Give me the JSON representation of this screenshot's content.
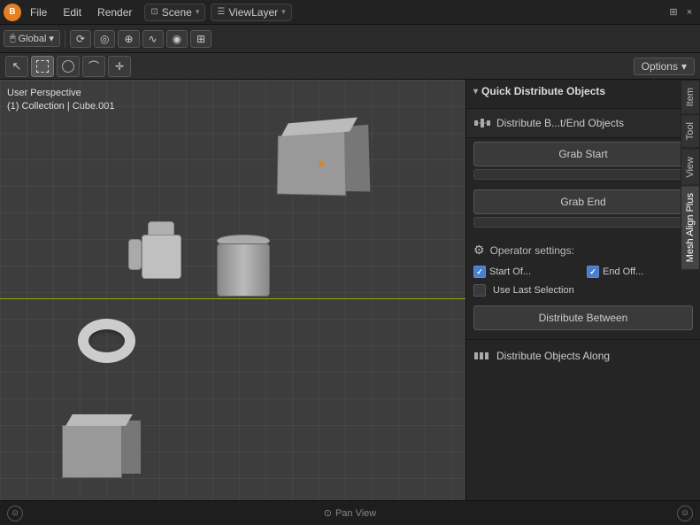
{
  "titlebar": {
    "app_icon": "B",
    "menus": [
      "File",
      "Edit",
      "Render"
    ],
    "scene_label": "Scene",
    "viewlayer_label": "ViewLayer",
    "close_icon": "×",
    "collapse_icon": "□",
    "minimize_icon": "—"
  },
  "toolbar": {
    "transform_icon": "↕",
    "global_label": "Global",
    "global_dropdown": "▾",
    "snap_icon": "⊕",
    "proportional_icon": "◎",
    "view_icon": "👁"
  },
  "mode_bar": {
    "select_box_active": true,
    "options_label": "Options",
    "options_dropdown": "▾"
  },
  "viewport": {
    "perspective_label": "User Perspective",
    "collection_label": "(1) Collection | Cube.001"
  },
  "right_panel": {
    "section_title": "Quick Distribute Objects",
    "drag_icon": "⠿",
    "distribute_label": "Distribute B...t/End Objects",
    "grab_start_label": "Grab Start",
    "grab_end_label": "Grab End",
    "operator_settings_label": "Operator settings:",
    "start_offset_label": "Start Of...",
    "end_offset_label": "End Off...",
    "use_last_selection_label": "Use Last Selection",
    "distribute_between_label": "Distribute Between",
    "distribute_objects_along_label": "Distribute Objects Along",
    "start_offset_checked": true,
    "end_offset_checked": true,
    "use_last_checked": false
  },
  "side_tabs": {
    "item_label": "Item",
    "tool_label": "Tool",
    "view_label": "View",
    "mesh_align_plus_label": "Mesh Align Plus"
  },
  "status_bar": {
    "left_icon": "⊙",
    "pan_view_label": "Pan View",
    "right_icon": "⊙"
  }
}
